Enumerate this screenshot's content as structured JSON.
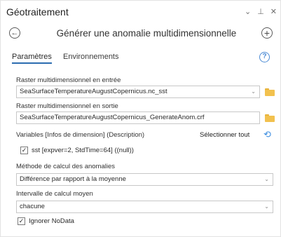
{
  "pane": {
    "title": "Géotraitement",
    "controls": {
      "menu": "⌄",
      "pin": "⊥",
      "close": "✕"
    }
  },
  "tool": {
    "back_icon": "←",
    "name": "Générer une anomalie multidimensionnelle",
    "add_icon": "+"
  },
  "tabs": {
    "parameters": "Paramètres",
    "environments": "Environnements",
    "help_icon": "?"
  },
  "params": {
    "input_raster_label": "Raster multidimensionnel en entrée",
    "input_raster_value": "SeaSurfaceTemperatureAugustCopernicus.nc_sst",
    "output_raster_label": "Raster multidimensionnel en sortie",
    "output_raster_value": "SeaSurfaceTemperatureAugustCopernicus_GenerateAnom.crf",
    "variables_label": "Variables [Infos de dimension] (Description)",
    "select_all": "Sélectionner tout",
    "variable_item": "sst [expver=2, StdTime=64] ((null))",
    "method_label": "Méthode de calcul des anomalies",
    "method_value": "Différence par rapport à la moyenne",
    "interval_label": "Intervalle de calcul moyen",
    "interval_value": "chacune",
    "ignore_nodata": "Ignorer NoData"
  },
  "icons": {
    "dropdown": "⌄",
    "reset": "⟲",
    "check": "✓"
  }
}
